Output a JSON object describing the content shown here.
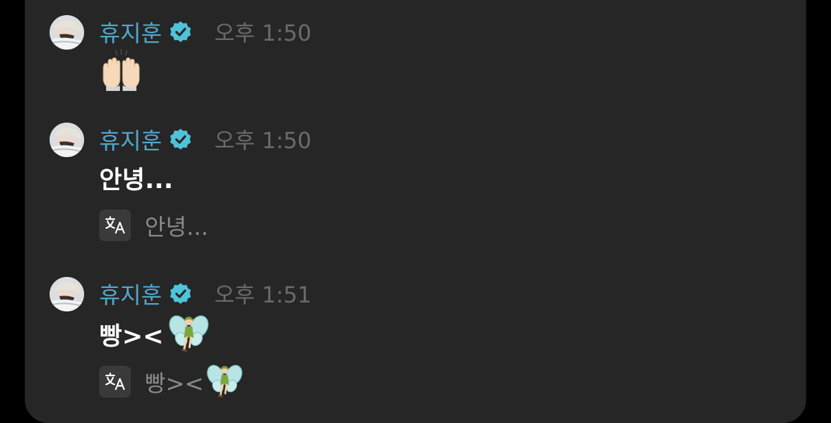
{
  "messages": [
    {
      "author": "휴지훈",
      "verified": true,
      "time": "오후 1:50",
      "text": "",
      "emoji": "raising-hands-emoji",
      "translation": null
    },
    {
      "author": "휴지훈",
      "verified": true,
      "time": "오후 1:50",
      "text": "안녕...",
      "emoji": null,
      "translation": "안녕..."
    },
    {
      "author": "휴지훈",
      "verified": true,
      "time": "오후 1:51",
      "text": "빵><",
      "emoji": "fairy-emoji",
      "translation": "빵><"
    }
  ],
  "colors": {
    "background": "#000000",
    "panel": "#262626",
    "author": "#4fa8cf",
    "verified_badge": "#4fc3d9",
    "time": "#6b6b6b",
    "message_text": "#ffffff",
    "translation_text": "#8a8a8a",
    "translate_button": "#3a3a3a"
  }
}
